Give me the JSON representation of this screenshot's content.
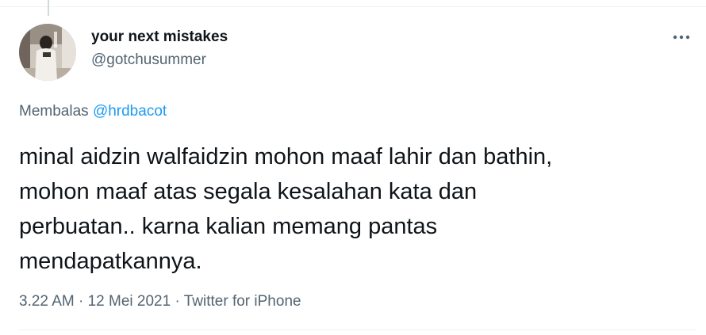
{
  "tweet": {
    "author": {
      "display_name": "your next mistakes",
      "handle": "@gotchusummer"
    },
    "reply": {
      "prefix": "Membalas",
      "mention": "@hrdbacot"
    },
    "text": "minal aidzin walfaidzin mohon maaf lahir dan bathin,\nmohon maaf atas segala kesalahan kata dan\nperbuatan.. karna kalian memang pantas\nmendapatkannya.",
    "meta": {
      "time": "3.22 AM",
      "separator": "·",
      "date": "12 Mei 2021",
      "source": "Twitter for iPhone"
    }
  },
  "icons": {
    "more": "more-horizontal-icon"
  },
  "colors": {
    "text_primary": "#0f1419",
    "text_secondary": "#536471",
    "link": "#1d9bf0",
    "divider": "#eff3f4"
  }
}
